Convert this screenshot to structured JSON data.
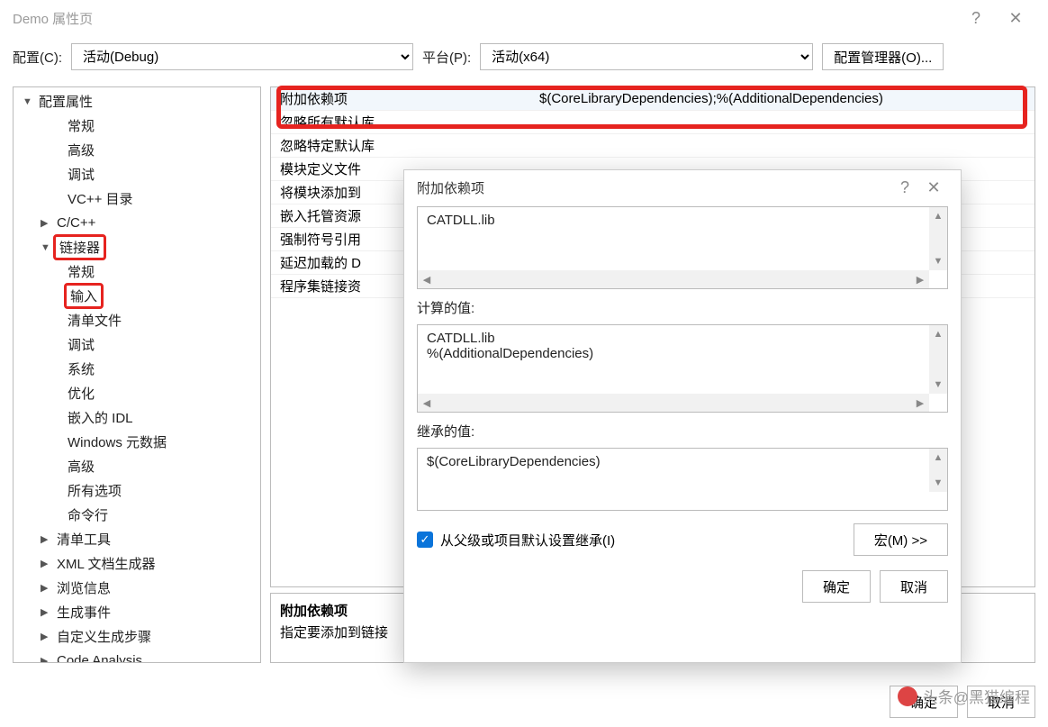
{
  "title": "Demo 属性页",
  "toolbar": {
    "config_label": "配置(C):",
    "config_value": "活动(Debug)",
    "platform_label": "平台(P):",
    "platform_value": "活动(x64)",
    "config_mgr": "配置管理器(O)..."
  },
  "tree": {
    "root": "配置属性",
    "items_a": [
      "常规",
      "高级",
      "调试",
      "VC++ 目录"
    ],
    "cc": "C/C++",
    "linker": "链接器",
    "linker_items": [
      "常规",
      "输入",
      "清单文件",
      "调试",
      "系统",
      "优化",
      "嵌入的 IDL",
      "Windows 元数据",
      "高级",
      "所有选项",
      "命令行"
    ],
    "tail": [
      "清单工具",
      "XML 文档生成器",
      "浏览信息",
      "生成事件",
      "自定义生成步骤",
      "Code Analysis"
    ]
  },
  "grid": {
    "rows": [
      {
        "label": "附加依赖项",
        "value": "$(CoreLibraryDependencies);%(AdditionalDependencies)"
      },
      {
        "label": "忽略所有默认库",
        "value": ""
      },
      {
        "label": "忽略特定默认库",
        "value": ""
      },
      {
        "label": "模块定义文件",
        "value": ""
      },
      {
        "label": "将模块添加到",
        "value": ""
      },
      {
        "label": "嵌入托管资源",
        "value": ""
      },
      {
        "label": "强制符号引用",
        "value": ""
      },
      {
        "label": "延迟加载的 D",
        "value": ""
      },
      {
        "label": "程序集链接资",
        "value": ""
      }
    ]
  },
  "desc": {
    "heading": "附加依赖项",
    "text": "指定要添加到链接"
  },
  "modal": {
    "title": "附加依赖项",
    "edit_value": "CATDLL.lib",
    "computed_label": "计算的值:",
    "computed_l1": "CATDLL.lib",
    "computed_l2": "%(AdditionalDependencies)",
    "inherited_label": "继承的值:",
    "inherited_l1": "$(CoreLibraryDependencies)",
    "inherit_checkbox": "从父级或项目默认设置继承(I)",
    "macro_btn": "宏(M) >>",
    "ok": "确定",
    "cancel": "取消"
  },
  "footer": {
    "ok": "确定",
    "cancel": "取消"
  },
  "watermark": "头条@黑猫编程"
}
